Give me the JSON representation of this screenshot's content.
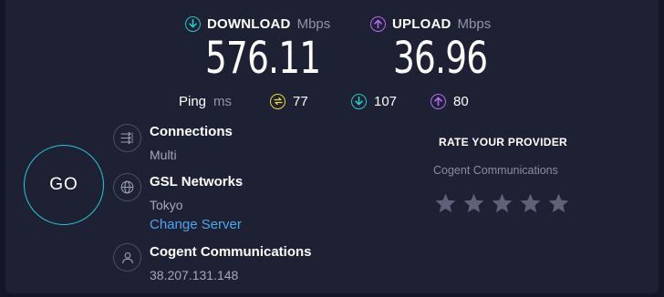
{
  "download": {
    "label": "DOWNLOAD",
    "unit": "Mbps",
    "value": "576.11",
    "icon": "arrow-down-circle-icon",
    "color": "#26c6c9"
  },
  "upload": {
    "label": "UPLOAD",
    "unit": "Mbps",
    "value": "36.96",
    "icon": "arrow-up-circle-icon",
    "color": "#b36bf5"
  },
  "ping": {
    "label": "Ping",
    "unit": "ms",
    "idle": {
      "value": "77",
      "icon": "idle-latency-icon",
      "color": "#ecd73a"
    },
    "download_latency": {
      "value": "107",
      "icon": "arrow-down-circle-icon",
      "color": "#26c6c9"
    },
    "upload_latency": {
      "value": "80",
      "icon": "arrow-up-circle-icon",
      "color": "#b36bf5"
    }
  },
  "go_button": {
    "label": "GO",
    "color": "#28c7d8"
  },
  "connections": {
    "title": "Connections",
    "value": "Multi",
    "icon": "connections-icon"
  },
  "server": {
    "title": "GSL Networks",
    "location": "Tokyo",
    "change_link": "Change Server",
    "icon": "globe-icon"
  },
  "provider": {
    "title": "Cogent Communications",
    "ip": "38.207.131.148",
    "icon": "user-icon"
  },
  "rating": {
    "title": "RATE YOUR PROVIDER",
    "provider": "Cogent Communications",
    "star_count": 5,
    "rating_selected": 0,
    "star_color": "#5f6178"
  }
}
